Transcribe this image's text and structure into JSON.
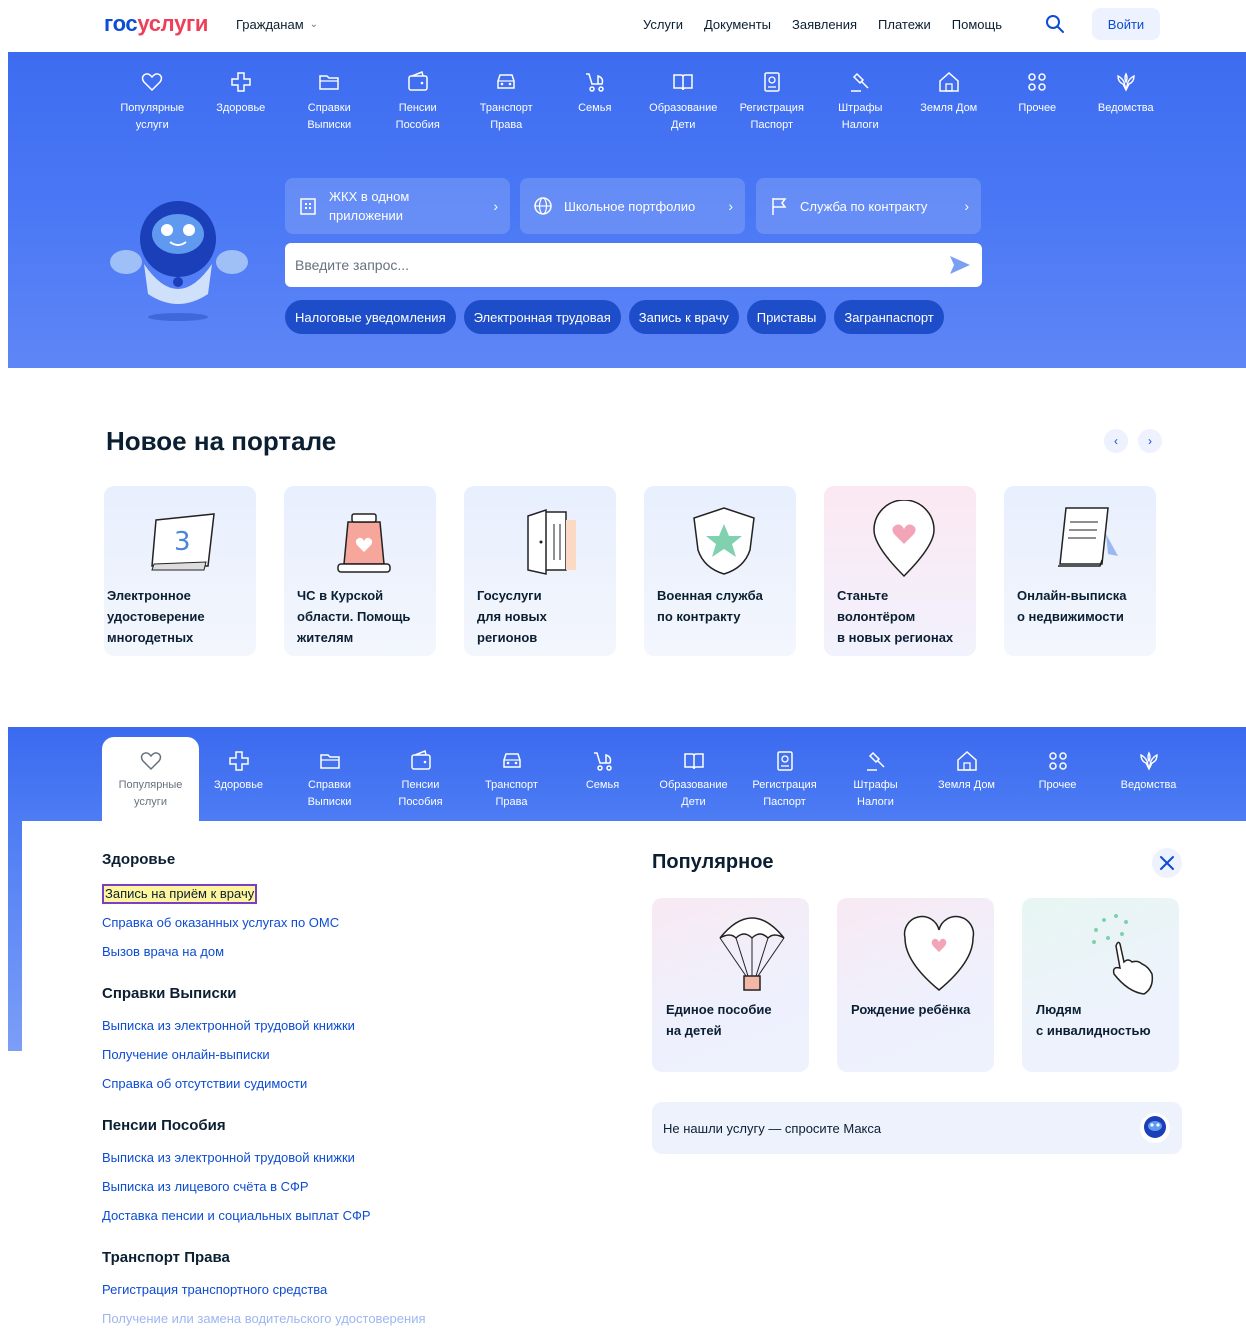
{
  "header": {
    "logo_part1": "гос",
    "logo_part2": "услуги",
    "audience": "Гражданам",
    "nav": [
      "Услуги",
      "Документы",
      "Заявления",
      "Платежи",
      "Помощь"
    ],
    "login": "Войти"
  },
  "categories": [
    {
      "label": "Популярные\nуслуги",
      "icon": "heart-icon"
    },
    {
      "label": "Здоровье",
      "icon": "health-cross-icon"
    },
    {
      "label": "Справки\nВыписки",
      "icon": "folder-icon"
    },
    {
      "label": "Пенсии\nПособия",
      "icon": "wallet-icon"
    },
    {
      "label": "Транспорт\nПрава",
      "icon": "car-icon"
    },
    {
      "label": "Семья",
      "icon": "stroller-icon"
    },
    {
      "label": "Образование\nДети",
      "icon": "book-icon"
    },
    {
      "label": "Регистрация\nПаспорт",
      "icon": "passport-icon"
    },
    {
      "label": "Штрафы\nНалоги",
      "icon": "gavel-icon"
    },
    {
      "label": "Земля Дом",
      "icon": "house-icon"
    },
    {
      "label": "Прочее",
      "icon": "grid-icon"
    },
    {
      "label": "Ведомства",
      "icon": "emblem-icon"
    }
  ],
  "hero": {
    "quick_links": [
      {
        "label": "ЖКХ в одном\nприложении",
        "icon": "building-icon"
      },
      {
        "label": "Школьное портфолио",
        "icon": "globe-icon"
      },
      {
        "label": "Служба по контракту",
        "icon": "flag-icon"
      }
    ],
    "search_placeholder": "Введите запрос...",
    "chips": [
      "Налоговые уведомления",
      "Электронная трудовая",
      "Запись к врачу",
      "Приставы",
      "Загранпаспорт"
    ]
  },
  "news": {
    "title": "Новое на портале",
    "cards": [
      {
        "title": "Электронное\nудостоверение\nмногодетных",
        "icon": "id-card-icon"
      },
      {
        "title": "ЧС в Курской\nобласти. Помощь\nжителям",
        "icon": "alarm-light-icon"
      },
      {
        "title": "Госуслуги\nдля новых\nрегионов",
        "icon": "door-icon"
      },
      {
        "title": "Военная служба\nпо контракту",
        "icon": "shield-star-icon"
      },
      {
        "title": "Станьте\nволонтёром\nв новых регионах",
        "icon": "heart-pin-icon"
      },
      {
        "title": "Онлайн-выписка\nо недвижимости",
        "icon": "document-icon"
      }
    ]
  },
  "menu": {
    "sections": [
      {
        "title": "Здоровье",
        "links": [
          "Запись на приём к врачу",
          "Справка об оказанных услугах по ОМС",
          "Вызов врача на дом"
        ]
      },
      {
        "title": "Справки Выписки",
        "links": [
          "Выписка из электронной трудовой книжки",
          "Получение онлайн-выписки",
          "Справка об отсутствии судимости"
        ]
      },
      {
        "title": "Пенсии Пособия",
        "links": [
          "Выписка из электронной трудовой книжки",
          "Выписка из лицевого счёта в СФР",
          "Доставка пенсии и социальных выплат СФР"
        ]
      },
      {
        "title": "Транспорт Права",
        "links": [
          "Регистрация транспортного средства",
          "Получение или замена водительского удостоверения"
        ]
      }
    ],
    "popular_title": "Популярное",
    "popular_cards": [
      {
        "title": "Единое пособие\nна детей",
        "icon": "parachute-icon"
      },
      {
        "title": "Рождение ребёнка",
        "icon": "heart-icon"
      },
      {
        "title": "Людям\nс инвалидностью",
        "icon": "hand-icon"
      }
    ],
    "ask": "Не нашли услугу — спросите Макса"
  },
  "colors": {
    "brand_blue": "#0d4cd3",
    "brand_red": "#ee3f58",
    "hero_blue": "#4a78f5",
    "chip_blue": "#1e4dc9"
  }
}
